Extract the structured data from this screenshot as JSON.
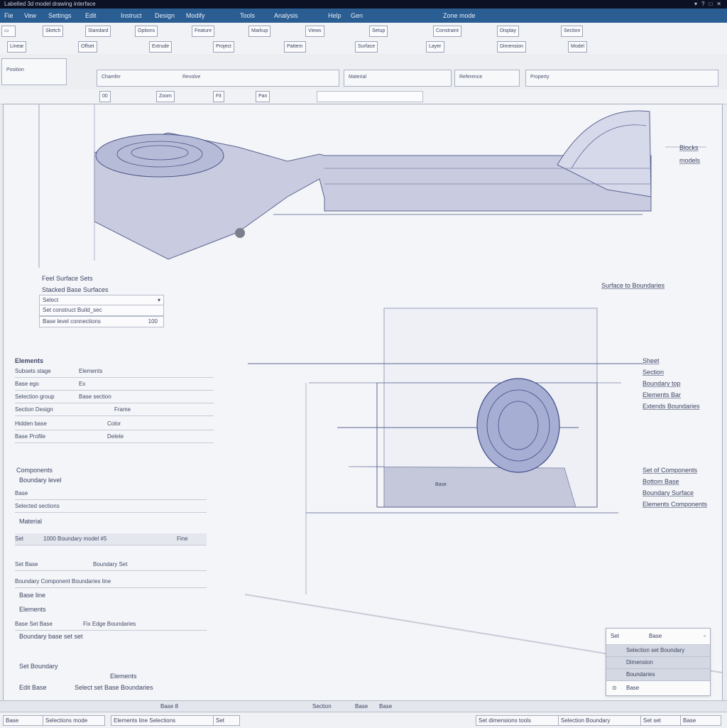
{
  "title_bar": {
    "title": "Labelled 3d model drawing interface",
    "controls": [
      "▾",
      "?",
      "□",
      "✕"
    ]
  },
  "menu": [
    "Fie",
    "Vew",
    "Settings",
    "Edit",
    "Instruct",
    "Design",
    "Modify",
    "Tools",
    "Analysis",
    "Help",
    "Gen",
    "Zone mode"
  ],
  "toolbar_row1": {
    "items": [
      "Sketch",
      "Standard",
      "Options",
      "Feature",
      "Markup",
      "Views",
      "Setup",
      "Constraint",
      "Display",
      "Section"
    ]
  },
  "toolbar_row2": {
    "items": [
      "Linear",
      "Offset",
      "Extrude",
      "Project",
      "Pattern",
      "Surface",
      "Layer",
      "Dimension",
      "Model"
    ]
  },
  "toolbar_row3": {
    "items": [
      "Position",
      "Chamfer",
      "Revolve",
      "Material",
      "Reference",
      "Property"
    ]
  },
  "toolbar_row4": {
    "search_value": "",
    "items": [
      "00",
      "Zoom",
      "Fit",
      "Pan"
    ]
  },
  "canvas": {
    "labels_right_top": [
      "Blocks",
      "models"
    ],
    "label_mid": "Surface to Boundaries",
    "labels_right_mid": [
      "Sheet",
      "Section",
      "Boundary top",
      "Elements Bar",
      "Extends Boundaries"
    ],
    "labels_right_low": [
      "Set of Components",
      "Bottom Base",
      "Boundary Surface",
      "Elements Components"
    ],
    "base_label": "Base",
    "panel1": {
      "title": "Feel Surface Sets",
      "subtitle": "Stacked Base Surfaces",
      "field1": "Select",
      "field2": "Set construct Build_sec",
      "field3": "Base level connections",
      "field3_value": "100"
    },
    "panel2": {
      "title": "Elements",
      "rows": [
        [
          "Subsets stage",
          "Elements"
        ],
        [
          "Base ego",
          "Ex"
        ],
        [
          "Selection group",
          "Base section"
        ],
        [
          "Section Design",
          "Frame"
        ],
        [
          "Hidden base",
          "Color"
        ],
        [
          "Base Profile",
          "Delete"
        ]
      ]
    },
    "panel3": {
      "title": "Components",
      "subtitle": "Boundary level",
      "rows": [
        "Base",
        "Selected sections"
      ],
      "section_title": "Material",
      "row_a": [
        "Set",
        "1000 Boundary model #5",
        "Fine"
      ],
      "row_b": [
        "Set Base",
        "Boundary Set"
      ],
      "row_c": "Boundary Component Boundaries line",
      "row_d": "Base line",
      "section2": "Elements",
      "row_e": [
        "Base Set Base",
        "Fix Edge Boundaries"
      ],
      "row_f": "Boundary base set set",
      "row_g": [
        "Set Boundary",
        "Elements",
        "Edit Base",
        "Select set Base Boundaries"
      ]
    }
  },
  "popup": {
    "header": [
      "Set",
      "Base"
    ],
    "items": [
      "Selection set Boundary",
      "Dimension",
      "Boundaries"
    ],
    "footer": "Base"
  },
  "status_bar": {
    "text": [
      "Base  8",
      "Section",
      "Base",
      "Base"
    ]
  },
  "status_bar2": {
    "items": [
      "Base",
      "Selections mode",
      "Elements line Selections",
      "Set",
      "Set dimensions tools",
      "Selection Boundary",
      "Set set",
      "Base"
    ]
  }
}
